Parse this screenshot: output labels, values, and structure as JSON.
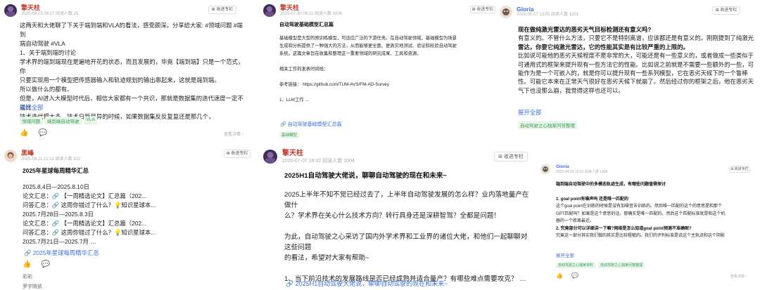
{
  "colors": {
    "accent": "#3a6fd8",
    "username": "#c0392b",
    "tag_bg": "#e8f5ea",
    "tag_text": "#3a9a50"
  },
  "icons": {
    "like": "thumbs-up-icon",
    "comment": "comment-icon",
    "link": "link-icon",
    "more": "chevron-down-icon"
  },
  "common": {
    "follow": "收进专栏",
    "expand": "展开全部",
    "view_more": "查看详情 ›"
  },
  "post1": {
    "user": "擎天柱",
    "meta": "2025-09-15 09:27  阅读人数 25",
    "lines": [
      "这两天和大佬聊了下关于端到端和VLA的看法，感受颇深，分享给大家: #领域问题 #端到",
      "端自动驾驶 #VLA",
      "1、关于端到端的讨论",
      "学术界的端到端现在是遍地开花的状态，而且发展的，毕竟【端到端】只是一个范式，你",
      "只要实现用一个模型把传感器输入和轨迹规划的输出串起来，这就是端到端。",
      "所以做什么的都有。",
      "但是，AI进入大模型时代后，相信大家都有一个共识，那就是数据集的迭代速度一定不能比",
      "技术迭代慢太多，技术日新月异的时候，如果数据集反反复复还是那几个，"
    ],
    "tags": [
      "领域问题",
      "端到端自动驾驶",
      "VLA"
    ]
  },
  "post2": {
    "user": "擎天柱",
    "meta": "2025-07-30 09:21  阅读人数 1006",
    "title": "自动驾驶基础模型汇总篇",
    "lines": [
      "基础模型是大型的预训练模型，可适应广泛的下游任务。在自动驾驶领域，基础模型为场景",
      "生成和分析提供了一种强大的方法，从而能够更全面、更真实地测试、验证和校验自动驾驶",
      "系统。这篇文章旨在收集和整理这一重要领域的研究成果、工具和资源。",
      "",
      "相关工作的发表时间线：",
      "",
      "参考链接：  https://github.com/TUM-AVS/FM-AD-Survey",
      "",
      "1、LLM工作 …"
    ],
    "link": "自动驾驶基础模型汇总篇",
    "tag": "基础模型"
  },
  "post3": {
    "user": "Gloria",
    "meta": "2025-05-17 13:50  阅读人数 1201",
    "question": "现在做纯激光雷达的恶劣天气目标检测还有意义吗?",
    "lines": [
      "有意义的。不管什么方法，只要它不是特别离谱，应该都还是有意义的。刚刚提到了纯激光",
      "雷达，你要它纯激光雷达，它的性能其实是有比较严重的上限的。",
      "比如说可能他的恶劣天候程度不是非常的大，可能还是有一些意义的，或者做成一些类似于",
      "可通用式的框架来提升现有一些方法它的性能。比如说之前就是不需要一些额外的一些，可",
      "能作为是一个可嵌入的，就是你可以提升现有一些系列模型，它在恶劣天候下的一个鲁棒",
      "性。可能它本来在正常天气很好在恶劣天候下就崩了。然后经过你的框架之后，他在恶劣天",
      "气下也没那么崩，我觉得这样也还可以。"
    ],
    "tag": "自动驾驶之心独家问答整理"
  },
  "post4": {
    "user": "黑峰",
    "meta": "2025-08-11 21:12  阅读人数 322",
    "title": "2025年星球每周精华汇总",
    "lines": [
      "2025.8.4日—2025.8.10日",
      "论文汇总：🔗 【一周精选论文】汇总篇（202...",
      "问答汇总：🔗 这周你错过了什么？💡知识星球本...",
      "2025.7月28日—2025.8.3日",
      "论文汇总：🔗 【一周精选论文】汇总篇（202...",
      "问答汇总：🔗 这周你错过了什么？💡知识星球本...",
      "2025.7月21日—2025.7月 …"
    ],
    "link": "2025年星球每周精华汇总",
    "foot1": "彩彩",
    "foot2": "罗宇晓凯"
  },
  "post5": {
    "user": "擎天柱",
    "meta": "2025-07-07 18:42  阅读人数 1004",
    "title": "2025H1自动驾驶大佬说，聊聊自动驾驶的现在和未来~",
    "lines": [
      "2025上半年不知不觉已经过去了，上半年自动驾驶发展的怎么样？业内落地量产在做什",
      "么？学术界在关心什么技术方向？转行具身还是深耕智驾？全都是问题！",
      "",
      "为此，自动驾驶之心采访了国内外学术界和工业界的诸位大佬，和他们一起聊聊对这些问题",
      "的看法，希望对大家有帮助~",
      "",
      "1、当下前沿技术的发展路线是否已经成熟并适合量产？有哪些难点需要攻克？  …"
    ],
    "link": "2025H1自动驾驶大佬说，聊聊自动驾驶的现在和未来~"
  },
  "post6": {
    "user": "Gloria",
    "meta": "2025-04-09 20:01  阅读人数 1408",
    "title": "端到端自动驾驶中的多模态轨迹生成，有哪些问题值得探讨",
    "lines": [
      "1. goal point有噪声吗 还是唯一匹配的",
      "这个goal point在训练的时候是没有加噪音去训练的。然后唯一匹配的这个的意思是和那个",
      "GPT匹配吗？如果是这个意思的话，那确实是唯一匹配的。然后这个匹配标准就是和这个机",
      "器的一个距离最近。",
      "2. 究竟部分可以详细讲一下嘛?网络是怎么知道goal point预测不准确呢?",
      "究竟这一部分其实我们做的其实是比较粗糙的。我们的评判标准是说这个主轨迹和这个阴影"
    ],
    "tags": [
      "自动驾驶之心独家资料",
      "自动驾驶之心独家问答整理"
    ]
  }
}
